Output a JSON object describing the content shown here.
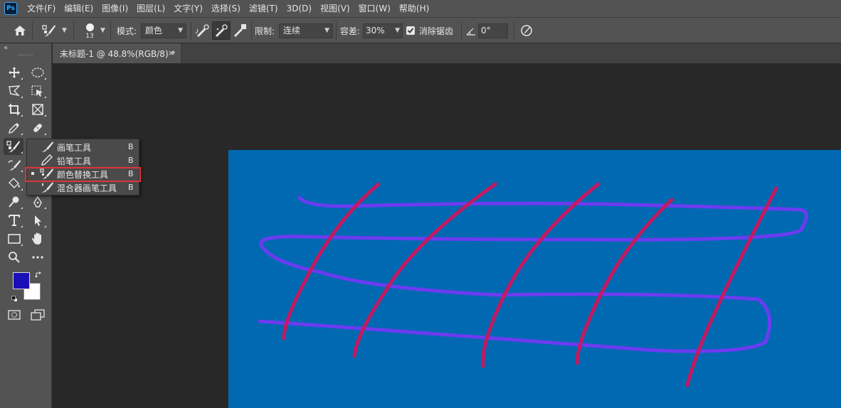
{
  "app": {
    "logo": "Ps"
  },
  "menu": [
    "文件(F)",
    "编辑(E)",
    "图像(I)",
    "图层(L)",
    "文字(Y)",
    "选择(S)",
    "滤镜(T)",
    "3D(D)",
    "视图(V)",
    "窗口(W)",
    "帮助(H)"
  ],
  "options": {
    "brush_size": "13",
    "mode_label": "模式:",
    "mode_value": "颜色",
    "limit_label": "限制:",
    "limit_value": "连续",
    "tolerance_label": "容差:",
    "tolerance_value": "30%",
    "antialias_label": "消除锯齿",
    "antialias_checked": true,
    "angle_value": "0°"
  },
  "document": {
    "tab_title": "未标题-1 @ 48.8%(RGB/8) *",
    "close_glyph": "×"
  },
  "colors": {
    "foreground": "#1a0fb8",
    "background": "#ffffff",
    "canvas_fill": "#0069b1",
    "horizontal_stroke": "#6b3cf0",
    "diagonal_stroke": "#c41a62",
    "highlight_box": "#e0333a"
  },
  "flyout": {
    "items": [
      {
        "label": "画笔工具",
        "shortcut": "B",
        "icon": "brush-icon",
        "active": false
      },
      {
        "label": "铅笔工具",
        "shortcut": "B",
        "icon": "pencil-icon",
        "active": false
      },
      {
        "label": "颜色替换工具",
        "shortcut": "B",
        "icon": "color-replacement-icon",
        "active": true
      },
      {
        "label": "混合器画笔工具",
        "shortcut": "B",
        "icon": "mixer-brush-icon",
        "active": false
      }
    ]
  },
  "tools": [
    "move-tool",
    "elliptical-marquee-tool",
    "lasso-tool",
    "object-selection-tool",
    "crop-tool",
    "frame-tool",
    "eyedropper-tool",
    "healing-brush-tool",
    "color-replacement-tool",
    "clone-stamp-tool",
    "history-brush-tool",
    "eraser-tool",
    "paint-bucket-tool",
    "blur-tool",
    "dodge-tool",
    "pen-tool",
    "type-tool",
    "path-selection-tool",
    "rectangle-tool",
    "hand-tool",
    "zoom-tool",
    "more-tools",
    "color-swatches",
    "quick-mask",
    "screen-mode"
  ]
}
